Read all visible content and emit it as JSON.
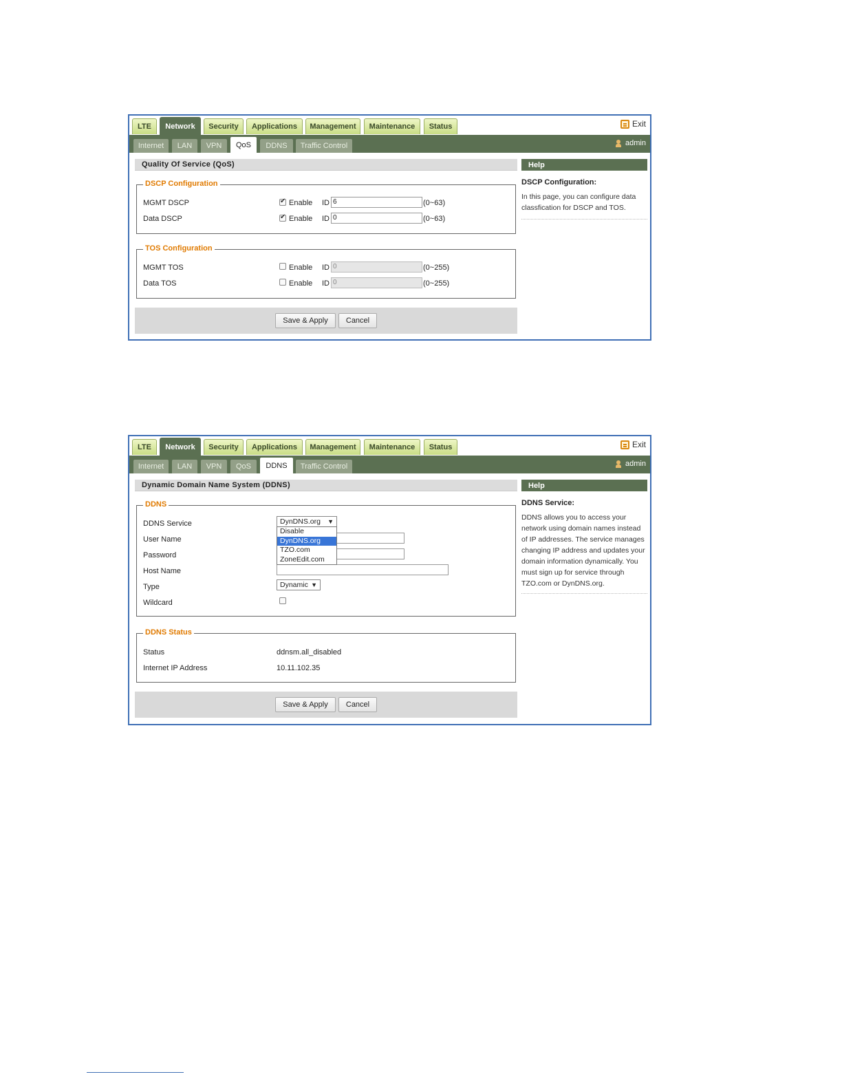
{
  "shot1": {
    "top_tabs": [
      "LTE",
      "Network",
      "Security",
      "Applications",
      "Management",
      "Maintenance",
      "Status"
    ],
    "active_top_tab": "Network",
    "exit_label": "Exit",
    "sub_tabs": [
      "Internet",
      "LAN",
      "VPN",
      "QoS",
      "DDNS",
      "Traffic Control"
    ],
    "active_sub_tab": "QoS",
    "user_label": "admin",
    "section_title": "Quality Of Service (QoS)",
    "dscp": {
      "legend": "DSCP Configuration",
      "rows": [
        {
          "label": "MGMT DSCP",
          "enable_label": "Enable",
          "checked": true,
          "id_label": "ID",
          "value": "6",
          "range": "(0~63)"
        },
        {
          "label": "Data DSCP",
          "enable_label": "Enable",
          "checked": true,
          "id_label": "ID",
          "value": "0",
          "range": "(0~63)"
        }
      ]
    },
    "tos": {
      "legend": "TOS Configuration",
      "rows": [
        {
          "label": "MGMT TOS",
          "enable_label": "Enable",
          "checked": false,
          "id_label": "ID",
          "value": "0",
          "range": "(0~255)"
        },
        {
          "label": "Data TOS",
          "enable_label": "Enable",
          "checked": false,
          "id_label": "ID",
          "value": "0",
          "range": "(0~255)"
        }
      ]
    },
    "save_label": "Save & Apply",
    "cancel_label": "Cancel",
    "help": {
      "header": "Help",
      "title": "DSCP Configuration:",
      "body": "In this page, you can configure data classfication for DSCP and TOS."
    }
  },
  "shot2": {
    "top_tabs": [
      "LTE",
      "Network",
      "Security",
      "Applications",
      "Management",
      "Maintenance",
      "Status"
    ],
    "active_top_tab": "Network",
    "exit_label": "Exit",
    "sub_tabs": [
      "Internet",
      "LAN",
      "VPN",
      "QoS",
      "DDNS",
      "Traffic Control"
    ],
    "active_sub_tab": "DDNS",
    "user_label": "admin",
    "section_title": "Dynamic Domain Name System (DDNS)",
    "ddns": {
      "legend": "DDNS",
      "service_label": "DDNS Service",
      "service_value": "DynDNS.org",
      "service_options": [
        "Disable",
        "DynDNS.org",
        "TZO.com",
        "ZoneEdit.com"
      ],
      "service_selected_option": "DynDNS.org",
      "username_label": "User Name",
      "username_value": "",
      "password_label": "Password",
      "password_value": "",
      "hostname_label": "Host Name",
      "hostname_value": "",
      "type_label": "Type",
      "type_value": "Dynamic",
      "wildcard_label": "Wildcard",
      "wildcard_checked": false
    },
    "status": {
      "legend": "DDNS Status",
      "status_label": "Status",
      "status_value": "ddnsm.all_disabled",
      "ip_label": "Internet IP Address",
      "ip_value": "10.11.102.35"
    },
    "save_label": "Save & Apply",
    "cancel_label": "Cancel",
    "help": {
      "header": "Help",
      "title": "DDNS Service:",
      "body": "DDNS allows you to access your network using domain names instead of IP addresses. The service manages changing IP address and updates your domain information dynamically. You must sign up for service through TZO.com or DynDNS.org."
    }
  },
  "colors": {
    "frame": "#3f6fb5",
    "nav_dark": "#5b7052",
    "tab_light": "#c9dd86",
    "legend": "#e07a00",
    "dropdown_highlight": "#3875d7"
  }
}
